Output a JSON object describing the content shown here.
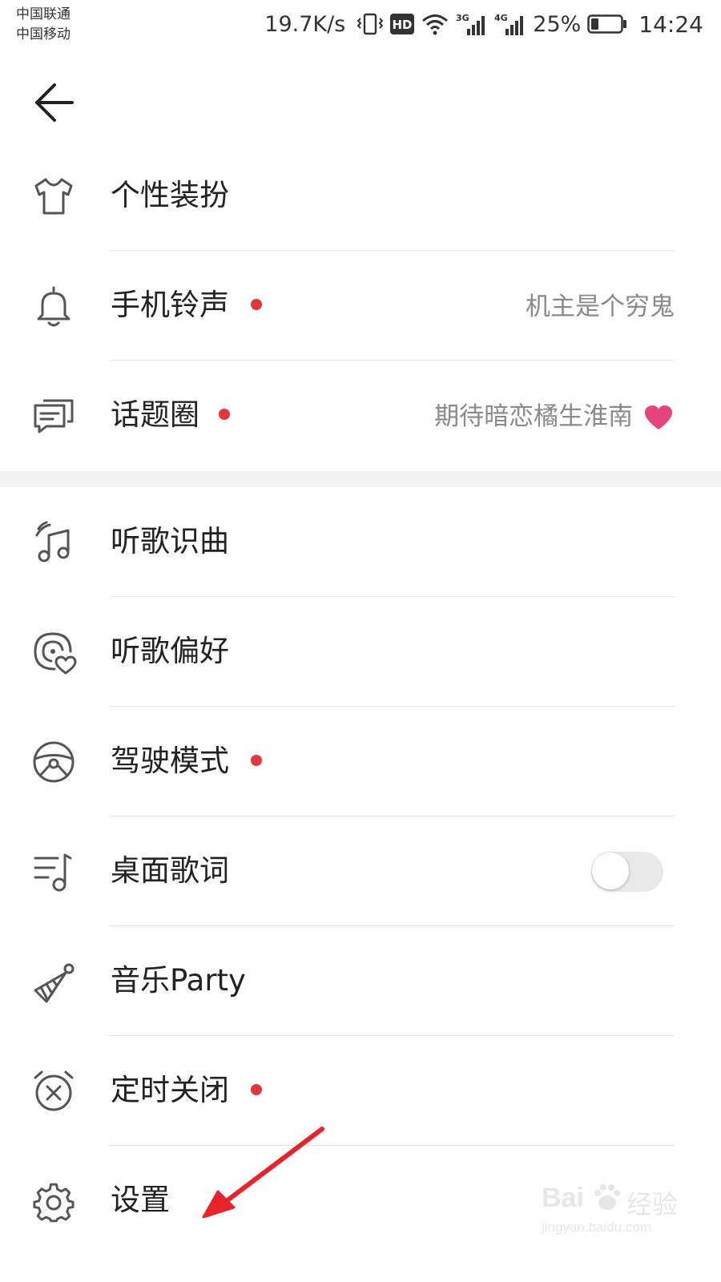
{
  "status_bar": {
    "carrier_1": "中国联通",
    "carrier_2": "中国移动",
    "net_speed": "19.7K/s",
    "hd_badge": "HD",
    "net_3g": "3G",
    "net_4g": "4G",
    "battery": "25%",
    "battery_level": 0.25,
    "time": "14:24"
  },
  "menu": {
    "items": [
      {
        "icon": "tshirt-icon",
        "label": "个性装扮",
        "dot": false
      },
      {
        "icon": "bell-icon",
        "label": "手机铃声",
        "dot": true,
        "right_text": "机主是个穷鬼"
      },
      {
        "icon": "chat-bubble-icon",
        "label": "话题圈",
        "dot": true,
        "right_text": "期待暗恋橘生淮南"
      },
      {
        "icon": "music-recognition-icon",
        "label": "听歌识曲",
        "dot": false
      },
      {
        "icon": "preference-heart-icon",
        "label": "听歌偏好",
        "dot": false
      },
      {
        "icon": "steering-wheel-icon",
        "label": "驾驶模式",
        "dot": true
      },
      {
        "icon": "lyrics-icon",
        "label": "桌面歌词",
        "dot": false,
        "toggle_on": false
      },
      {
        "icon": "party-hat-icon",
        "label": "音乐Party",
        "dot": false
      },
      {
        "icon": "alarm-clock-icon",
        "label": "定时关闭",
        "dot": true
      },
      {
        "icon": "gear-icon",
        "label": "设置",
        "dot": false
      }
    ]
  },
  "colors": {
    "dot": "#e8353d",
    "heart": "#e5457a",
    "arrow": "#e8242a",
    "text": "#222222",
    "secondary": "#8a8a8a"
  },
  "watermark": {
    "brand_left": "Bai",
    "brand_right": "经验",
    "url": "jingyan.baidu.com"
  }
}
